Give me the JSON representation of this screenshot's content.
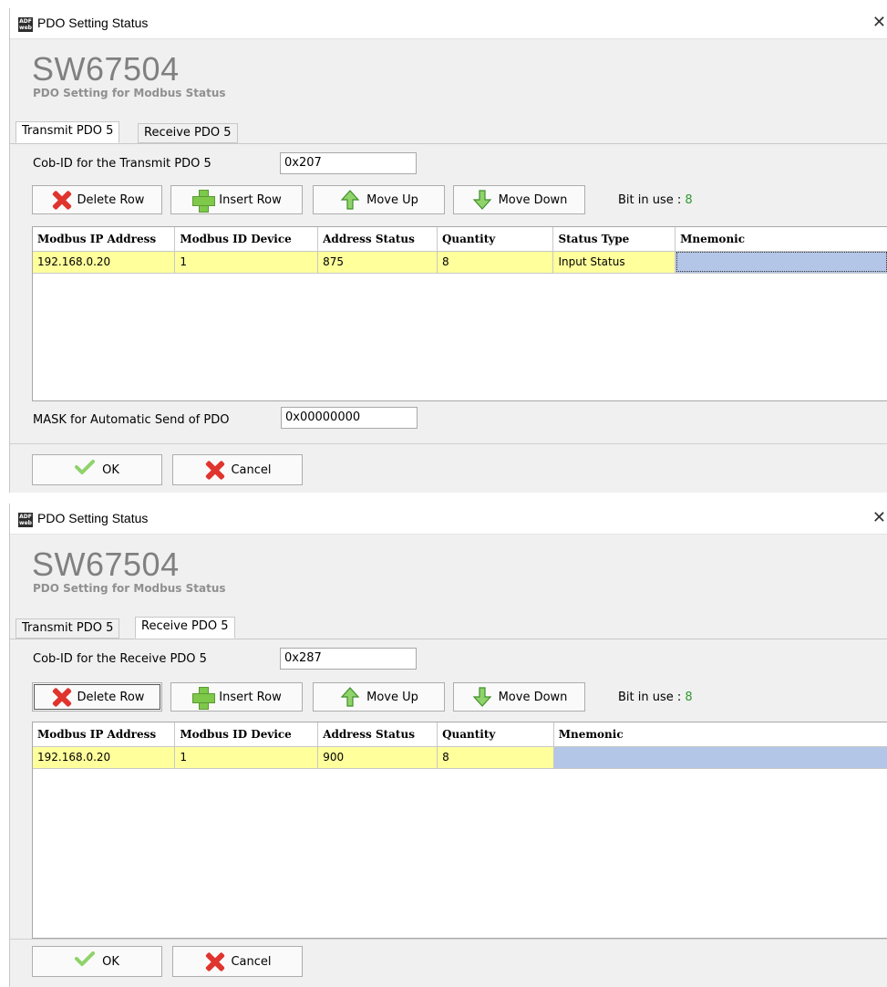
{
  "windows": [
    {
      "title": "PDO Setting Status",
      "app_icon_text": "ADF web",
      "header": {
        "title": "SW67504",
        "subtitle": "PDO Setting for Modbus Status"
      },
      "tabs": [
        {
          "label": "Transmit PDO 5",
          "active": true
        },
        {
          "label": "Receive PDO 5",
          "active": false
        }
      ],
      "cob_label": "Cob-ID for the Transmit PDO 5",
      "cob_value": "0x207",
      "toolbar": {
        "delete_label": "Delete Row",
        "insert_label": "Insert Row",
        "move_up_label": "Move Up",
        "move_down_label": "Move Down",
        "bit_label": "Bit in use : ",
        "bit_value": "8"
      },
      "columns": [
        "Modbus IP Address",
        "Modbus ID Device",
        "Address Status",
        "Quantity",
        "Status Type",
        "Mnemonic"
      ],
      "rows": [
        [
          "192.168.0.20",
          "1",
          "875",
          "8",
          "Input Status",
          ""
        ]
      ],
      "mask_label": "MASK for Automatic Send of PDO",
      "mask_value": "0x00000000",
      "ok_label": "OK",
      "cancel_label": "Cancel"
    },
    {
      "title": "PDO Setting Status",
      "app_icon_text": "ADF web",
      "header": {
        "title": "SW67504",
        "subtitle": "PDO Setting for Modbus Status"
      },
      "tabs": [
        {
          "label": "Transmit PDO 5",
          "active": false
        },
        {
          "label": "Receive PDO 5",
          "active": true
        }
      ],
      "cob_label": "Cob-ID for the Receive PDO 5",
      "cob_value": "0x287",
      "toolbar": {
        "delete_label": "Delete Row",
        "insert_label": "Insert Row",
        "move_up_label": "Move Up",
        "move_down_label": "Move Down",
        "bit_label": "Bit in use : ",
        "bit_value": "8"
      },
      "columns": [
        "Modbus IP Address",
        "Modbus ID Device",
        "Address Status",
        "Quantity",
        "Mnemonic"
      ],
      "rows": [
        [
          "192.168.0.20",
          "1",
          "900",
          "8",
          ""
        ]
      ],
      "ok_label": "OK",
      "cancel_label": "Cancel"
    }
  ],
  "colors": {
    "row_highlight": "#ffff9c",
    "mnemonic_cell": "#b4c6e7",
    "bit_value": "#2e9a2e",
    "delete_icon": "#e0342e",
    "insert_icon": "#7ec84a"
  }
}
